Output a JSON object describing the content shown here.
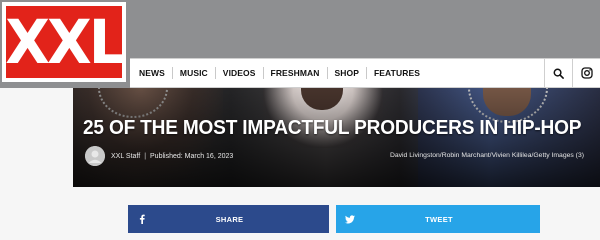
{
  "brand": {
    "logo_text": "XXL"
  },
  "nav": {
    "links": [
      {
        "label": "NEWS"
      },
      {
        "label": "MUSIC"
      },
      {
        "label": "VIDEOS"
      },
      {
        "label": "FRESHMAN"
      },
      {
        "label": "SHOP"
      },
      {
        "label": "FEATURES"
      }
    ],
    "icons": [
      "search-icon",
      "instagram-icon"
    ]
  },
  "article": {
    "title": "25 OF THE MOST IMPACTFUL PRODUCERS IN HIP-HOP",
    "author": "XXL Staff",
    "published": "Published: March 16, 2023",
    "photo_credit": "David Livingston/Robin Marchant/Vivien Killilea/Getty Images (3)"
  },
  "share": {
    "share_label": "SHARE",
    "tweet_label": "TWEET",
    "colors": {
      "facebook": "#2c4a8c",
      "twitter": "#27a4e8"
    }
  },
  "colors": {
    "brand_red": "#e2231a",
    "header_gray": "#8e8f91"
  }
}
